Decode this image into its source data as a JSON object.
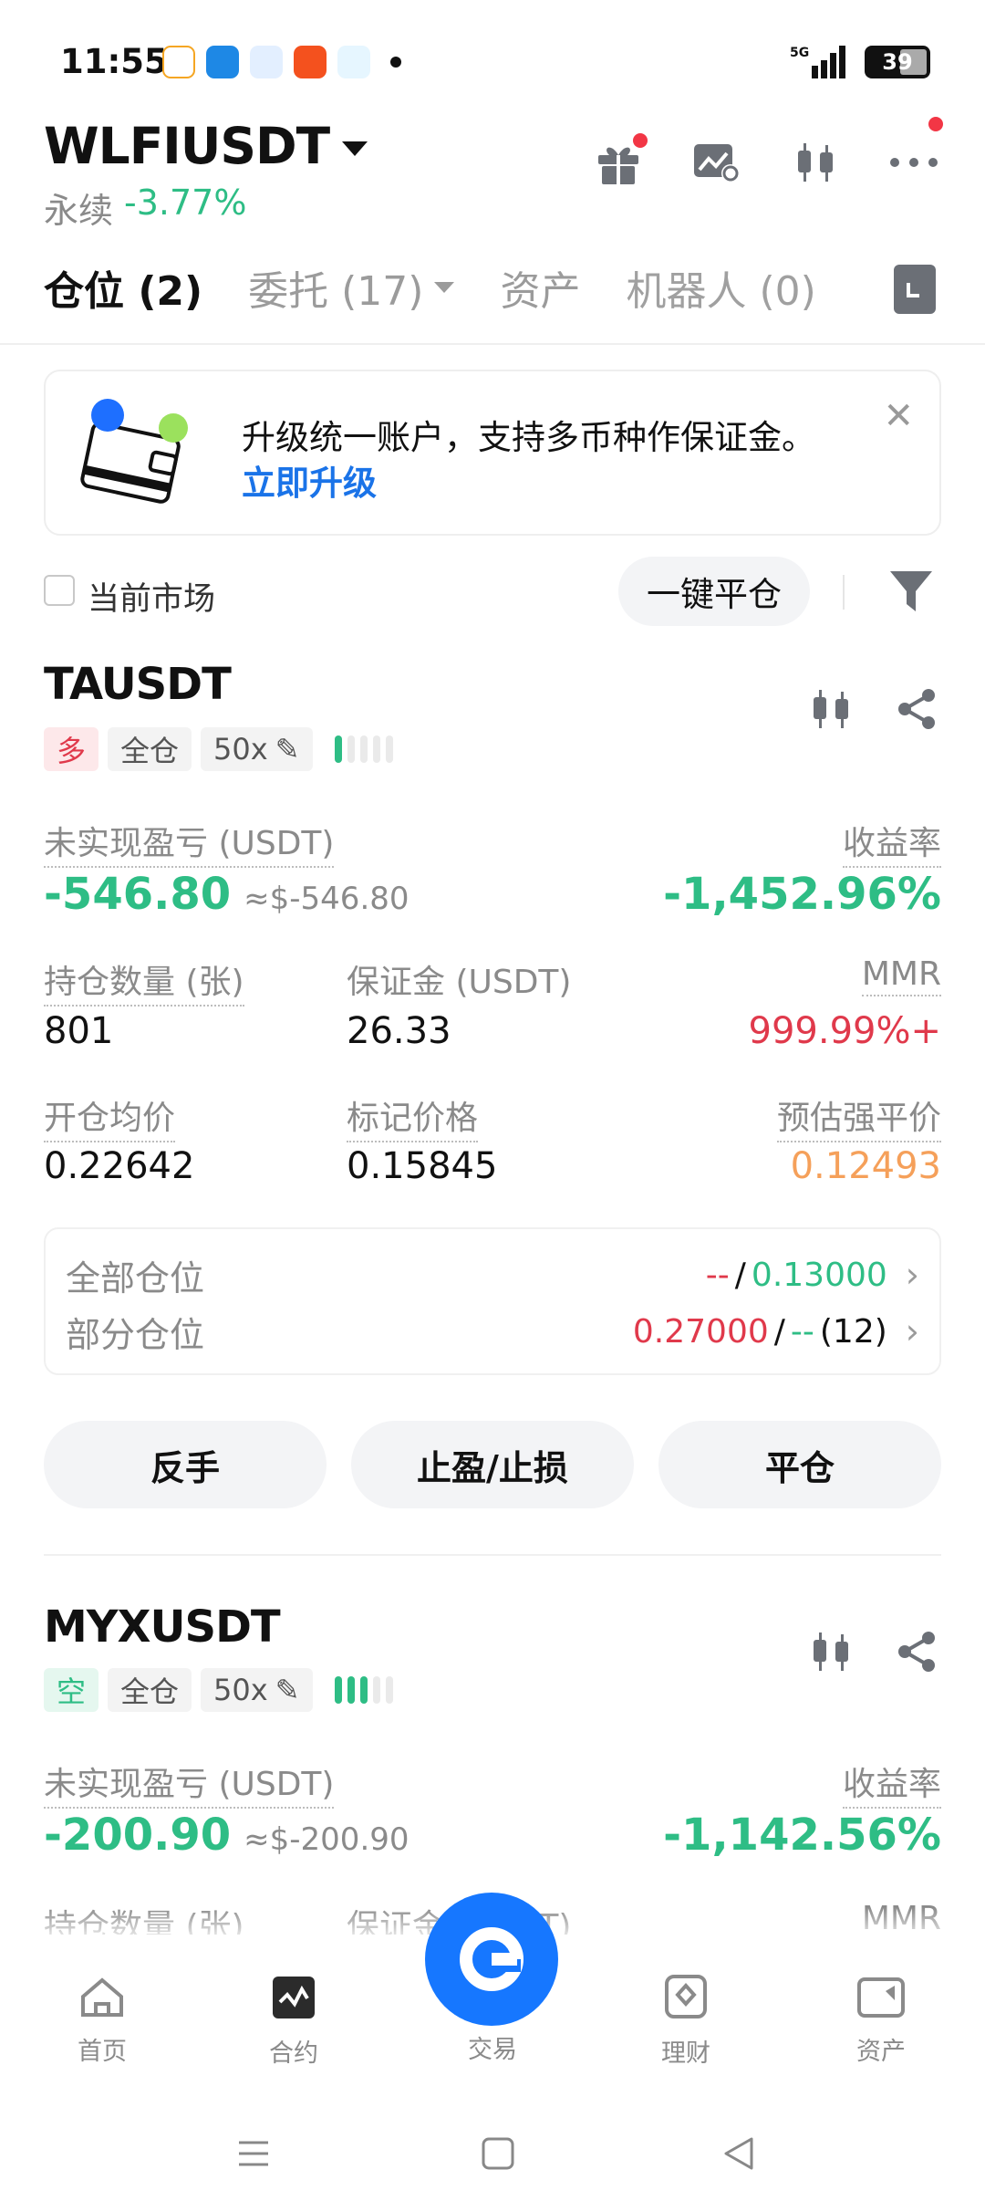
{
  "status_bar": {
    "time": "11:55",
    "battery": "39",
    "network": "5G"
  },
  "header": {
    "pair": "WLFIUSDT",
    "contract_type": "永续",
    "change": "-3.77%"
  },
  "tabs": [
    {
      "label": "仓位 (2)"
    },
    {
      "label": "委托 (17)"
    },
    {
      "label": "资产"
    },
    {
      "label": "机器人 (0)"
    }
  ],
  "banner": {
    "text": "升级统一账户，支持多币种作保证金。",
    "link": "立即升级"
  },
  "filters": {
    "current_market": "当前市场",
    "close_all": "一键平仓"
  },
  "labels": {
    "unrealized_pnl": "未实现盈亏 (USDT)",
    "roe": "收益率",
    "size": "持仓数量 (张)",
    "margin": "保证金 (USDT)",
    "mmr": "MMR",
    "entry_price": "开仓均价",
    "mark_price": "标记价格",
    "liq_price": "预估强平价",
    "full_position": "全部仓位",
    "partial_position": "部分仓位",
    "reverse": "反手",
    "tpsl": "止盈/止损",
    "close": "平仓"
  },
  "positions": [
    {
      "symbol": "TAUSDT",
      "side": "多",
      "margin_mode": "全仓",
      "leverage": "50x",
      "pnl": "-546.80",
      "pnl_usd": "≈$-546.80",
      "roe": "-1,452.96%",
      "size": "801",
      "margin": "26.33",
      "mmr": "999.99%+",
      "entry_price": "0.22642",
      "mark_price": "0.15845",
      "liq_price": "0.12493",
      "full_tp": "--",
      "full_sl": "0.13000",
      "partial_tp": "0.27000",
      "partial_sl": "--",
      "partial_count": "(12)",
      "risk_level": 1
    },
    {
      "symbol": "MYXUSDT",
      "side": "空",
      "margin_mode": "全仓",
      "leverage": "50x",
      "pnl": "-200.90",
      "pnl_usd": "≈$-200.90",
      "roe": "-1,142.56%",
      "risk_level": 3
    }
  ],
  "bottom_nav": [
    {
      "label": "首页"
    },
    {
      "label": "合约"
    },
    {
      "label": "交易"
    },
    {
      "label": "理财"
    },
    {
      "label": "资产"
    }
  ],
  "colors": {
    "green": "#2ebd85",
    "red": "#e0394b",
    "orange": "#f5a05a",
    "blue": "#1677ff"
  }
}
